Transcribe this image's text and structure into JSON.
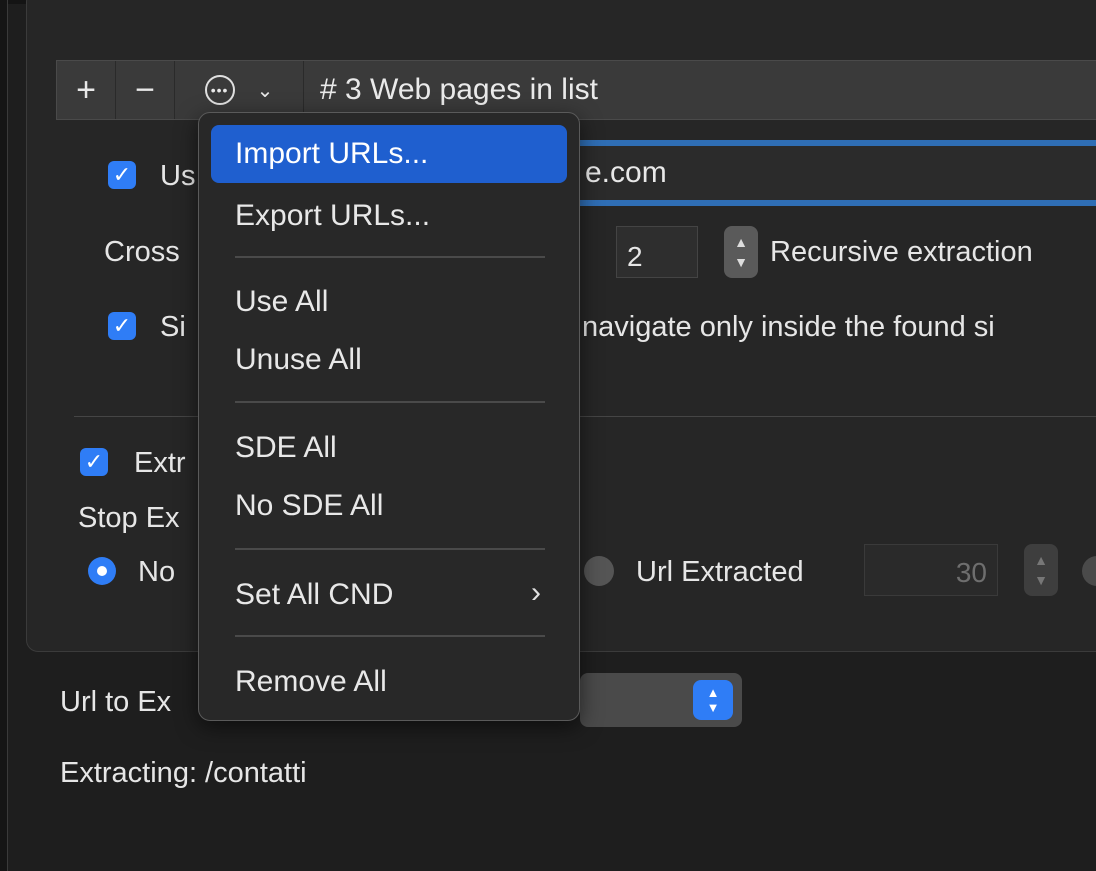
{
  "toolbar": {
    "plus": "+",
    "minus": "−",
    "more_chevron": "⌄",
    "title": "# 3 Web pages in list"
  },
  "rows": {
    "use_checkbox_label": "Us",
    "url_text": "e.com",
    "cross_label": "Cross",
    "depth_value": "2",
    "recursive_label": "Recursive extraction",
    "site_checkbox_label": "Si",
    "site_text": "navigate only inside the found si",
    "extract_checkbox_label": "Extr",
    "stop_label": "Stop Ex",
    "radio_no_label": "No",
    "radio_url_label": "Url Extracted",
    "url_extracted_value": "30"
  },
  "bottom": {
    "url_to_ex_label": "Url to Ex",
    "extracting": "Extracting: /contatti"
  },
  "menu": {
    "import": "Import URLs...",
    "export": "Export URLs...",
    "use_all": "Use All",
    "unuse_all": "Unuse All",
    "sde_all": "SDE All",
    "no_sde_all": "No SDE All",
    "set_all_cnd": "Set All CND",
    "remove_all": "Remove All"
  },
  "colors": {
    "accent": "#2f7df6",
    "highlight": "#1f5fcf",
    "background": "#1e1e1e"
  }
}
